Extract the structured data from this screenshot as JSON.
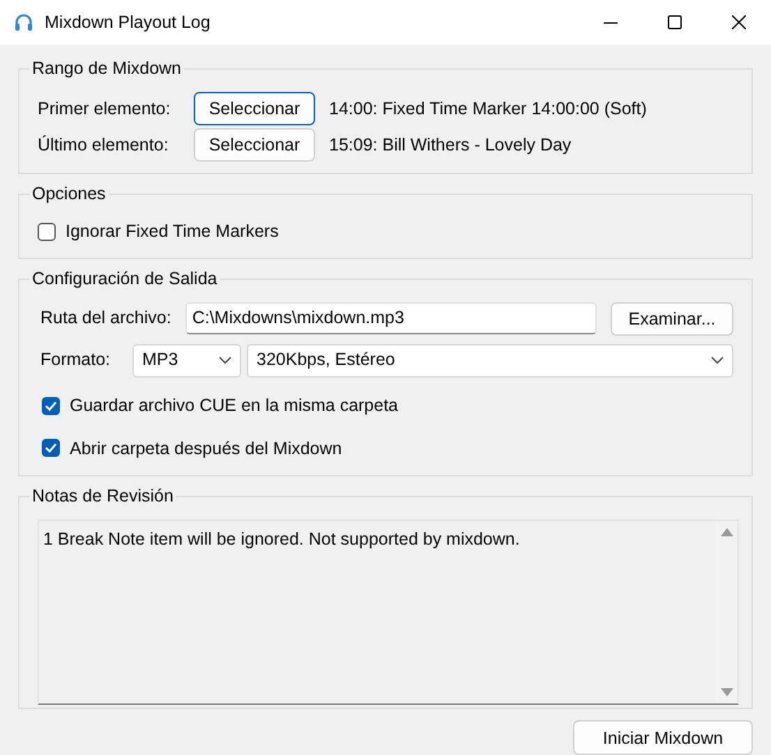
{
  "window": {
    "title": "Mixdown Playout Log"
  },
  "range": {
    "title": "Rango de Mixdown",
    "rows": [
      {
        "label": "Primer elemento:",
        "button": "Seleccionar",
        "focused": true,
        "value": "14:00: Fixed Time Marker 14:00:00 (Soft)"
      },
      {
        "label": "Último elemento:",
        "button": "Seleccionar",
        "focused": false,
        "value": "15:09: Bill Withers - Lovely Day"
      }
    ]
  },
  "options": {
    "title": "Opciones",
    "checkboxes": [
      {
        "label": "Ignorar Fixed Time Markers",
        "checked": false
      }
    ]
  },
  "output": {
    "title": "Configuración de Salida",
    "path_label": "Ruta del archivo:",
    "path_value": "C:\\Mixdowns\\mixdown.mp3",
    "browse_button": "Examinar...",
    "format_label": "Formato:",
    "format_value": "MP3",
    "quality_value": "320Kbps, Estéreo",
    "checkboxes": [
      {
        "label": "Guardar archivo CUE en la misma carpeta",
        "checked": true
      },
      {
        "label": "Abrir carpeta después del Mixdown",
        "checked": true
      }
    ]
  },
  "notes": {
    "title": "Notas de Revisión",
    "text": "1 Break Note item will be ignored. Not supported by mixdown."
  },
  "start_button": "Iniciar Mixdown"
}
